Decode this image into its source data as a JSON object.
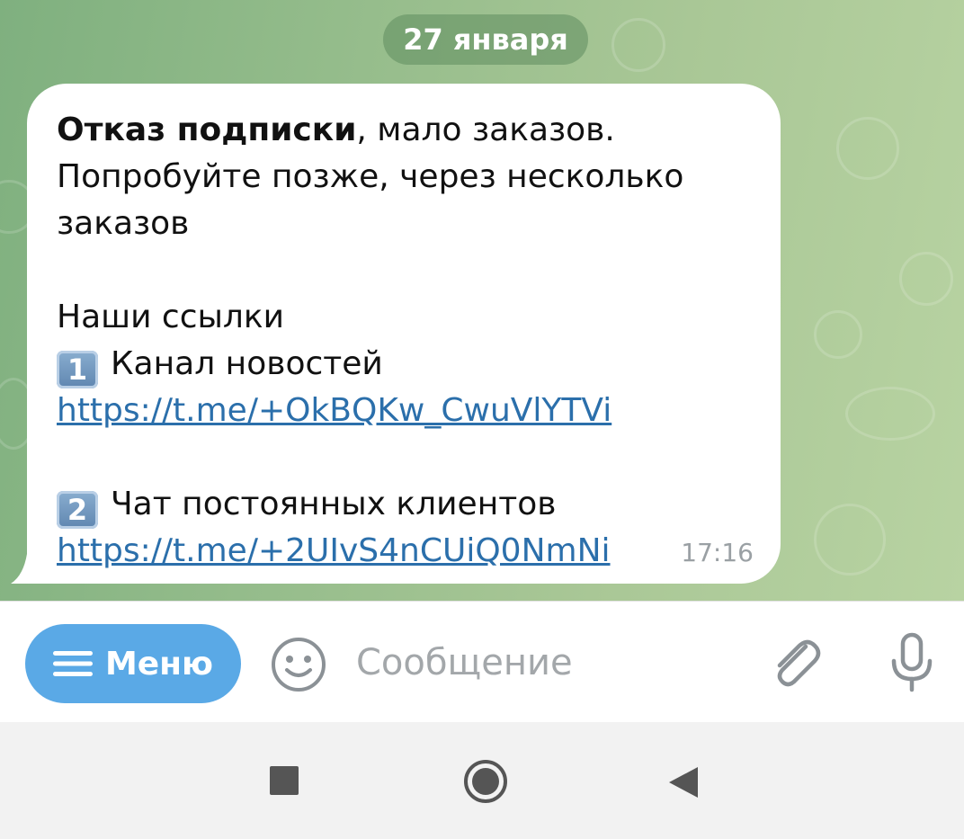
{
  "chat": {
    "date_label": "27 января",
    "message": {
      "bold_text": "Отказ подписки",
      "line1_rest": ", мало заказов.",
      "line2": "Попробуйте позже, через несколько",
      "line3": "заказов",
      "links_heading": "Наши ссылки",
      "item1_number": "1",
      "item1_label": "Канал новостей",
      "item1_link": "https://t.me/+OkBQKw_CwuVlYTVi",
      "item2_number": "2",
      "item2_label": "Чат постоянных клиентов",
      "item2_link": "https://t.me/+2UIvS4nCUiQ0NmNi",
      "time": "17:16"
    }
  },
  "input_bar": {
    "menu_label": "Меню",
    "message_placeholder": "Сообщение"
  },
  "colors": {
    "menu_button": "#5aa9e6",
    "link": "#2b6fab",
    "chat_background": "#96bd8c"
  }
}
